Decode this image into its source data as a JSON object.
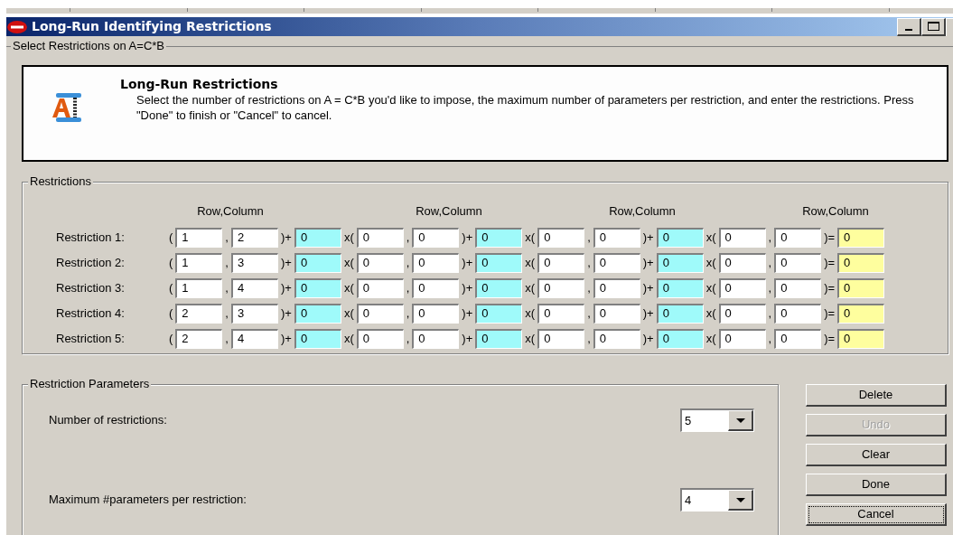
{
  "window": {
    "title": "Long-Run Identifying Restrictions"
  },
  "main_group": {
    "title": "Select Restrictions on A=C*B"
  },
  "info": {
    "heading": "Long-Run Restrictions",
    "text": "Select the number of restrictions on A = C*B you'd like to impose, the maximum number of parameters per restriction, and enter the restrictions. Press \"Done\" to finish or \"Cancel\" to cancel."
  },
  "restrictions": {
    "title": "Restrictions",
    "headers": [
      "Row,Column",
      "Row,Column",
      "Row,Column",
      "Row,Column"
    ],
    "rows": [
      {
        "label": "Restriction 1:",
        "items": [
          {
            "kind": "sep",
            "text": "("
          },
          {
            "kind": "cell",
            "value": "1"
          },
          {
            "kind": "sep",
            "text": ","
          },
          {
            "kind": "cell",
            "value": "2"
          },
          {
            "kind": "sep",
            "text": ")+"
          },
          {
            "kind": "coef",
            "value": "0"
          },
          {
            "kind": "sep",
            "text": "x("
          },
          {
            "kind": "cell",
            "value": "0"
          },
          {
            "kind": "sep",
            "text": ","
          },
          {
            "kind": "cell",
            "value": "0"
          },
          {
            "kind": "sep",
            "text": ")+"
          },
          {
            "kind": "coef",
            "value": "0"
          },
          {
            "kind": "sep",
            "text": "x("
          },
          {
            "kind": "cell",
            "value": "0"
          },
          {
            "kind": "sep",
            "text": ","
          },
          {
            "kind": "cell",
            "value": "0"
          },
          {
            "kind": "sep",
            "text": ")+"
          },
          {
            "kind": "coef",
            "value": "0"
          },
          {
            "kind": "sep",
            "text": "x("
          },
          {
            "kind": "cell",
            "value": "0"
          },
          {
            "kind": "sep",
            "text": ","
          },
          {
            "kind": "cell",
            "value": "0"
          },
          {
            "kind": "sep",
            "text": ")="
          },
          {
            "kind": "rhs",
            "value": "0"
          }
        ]
      },
      {
        "label": "Restriction 2:",
        "items": [
          {
            "kind": "sep",
            "text": "("
          },
          {
            "kind": "cell",
            "value": "1"
          },
          {
            "kind": "sep",
            "text": ","
          },
          {
            "kind": "cell",
            "value": "3"
          },
          {
            "kind": "sep",
            "text": ")+"
          },
          {
            "kind": "coef",
            "value": "0"
          },
          {
            "kind": "sep",
            "text": "x("
          },
          {
            "kind": "cell",
            "value": "0"
          },
          {
            "kind": "sep",
            "text": ","
          },
          {
            "kind": "cell",
            "value": "0"
          },
          {
            "kind": "sep",
            "text": ")+"
          },
          {
            "kind": "coef",
            "value": "0"
          },
          {
            "kind": "sep",
            "text": "x("
          },
          {
            "kind": "cell",
            "value": "0"
          },
          {
            "kind": "sep",
            "text": ","
          },
          {
            "kind": "cell",
            "value": "0"
          },
          {
            "kind": "sep",
            "text": ")+"
          },
          {
            "kind": "coef",
            "value": "0"
          },
          {
            "kind": "sep",
            "text": "x("
          },
          {
            "kind": "cell",
            "value": "0"
          },
          {
            "kind": "sep",
            "text": ","
          },
          {
            "kind": "cell",
            "value": "0"
          },
          {
            "kind": "sep",
            "text": ")="
          },
          {
            "kind": "rhs",
            "value": "0"
          }
        ]
      },
      {
        "label": "Restriction 3:",
        "items": [
          {
            "kind": "sep",
            "text": "("
          },
          {
            "kind": "cell",
            "value": "1"
          },
          {
            "kind": "sep",
            "text": ","
          },
          {
            "kind": "cell",
            "value": "4"
          },
          {
            "kind": "sep",
            "text": ")+"
          },
          {
            "kind": "coef",
            "value": "0"
          },
          {
            "kind": "sep",
            "text": "x("
          },
          {
            "kind": "cell",
            "value": "0"
          },
          {
            "kind": "sep",
            "text": ","
          },
          {
            "kind": "cell",
            "value": "0"
          },
          {
            "kind": "sep",
            "text": ")+"
          },
          {
            "kind": "coef",
            "value": "0"
          },
          {
            "kind": "sep",
            "text": "x("
          },
          {
            "kind": "cell",
            "value": "0"
          },
          {
            "kind": "sep",
            "text": ","
          },
          {
            "kind": "cell",
            "value": "0"
          },
          {
            "kind": "sep",
            "text": ")+"
          },
          {
            "kind": "coef",
            "value": "0"
          },
          {
            "kind": "sep",
            "text": "x("
          },
          {
            "kind": "cell",
            "value": "0"
          },
          {
            "kind": "sep",
            "text": ","
          },
          {
            "kind": "cell",
            "value": "0"
          },
          {
            "kind": "sep",
            "text": ")="
          },
          {
            "kind": "rhs",
            "value": "0"
          }
        ]
      },
      {
        "label": "Restriction 4:",
        "items": [
          {
            "kind": "sep",
            "text": "("
          },
          {
            "kind": "cell",
            "value": "2"
          },
          {
            "kind": "sep",
            "text": ","
          },
          {
            "kind": "cell",
            "value": "3"
          },
          {
            "kind": "sep",
            "text": ")+"
          },
          {
            "kind": "coef",
            "value": "0"
          },
          {
            "kind": "sep",
            "text": "x("
          },
          {
            "kind": "cell",
            "value": "0"
          },
          {
            "kind": "sep",
            "text": ","
          },
          {
            "kind": "cell",
            "value": "0"
          },
          {
            "kind": "sep",
            "text": ")+"
          },
          {
            "kind": "coef",
            "value": "0"
          },
          {
            "kind": "sep",
            "text": "x("
          },
          {
            "kind": "cell",
            "value": "0"
          },
          {
            "kind": "sep",
            "text": ","
          },
          {
            "kind": "cell",
            "value": "0"
          },
          {
            "kind": "sep",
            "text": ")+"
          },
          {
            "kind": "coef",
            "value": "0"
          },
          {
            "kind": "sep",
            "text": "x("
          },
          {
            "kind": "cell",
            "value": "0"
          },
          {
            "kind": "sep",
            "text": ","
          },
          {
            "kind": "cell",
            "value": "0"
          },
          {
            "kind": "sep",
            "text": ")="
          },
          {
            "kind": "rhs",
            "value": "0"
          }
        ]
      },
      {
        "label": "Restriction 5:",
        "items": [
          {
            "kind": "sep",
            "text": "("
          },
          {
            "kind": "cell",
            "value": "2"
          },
          {
            "kind": "sep",
            "text": ","
          },
          {
            "kind": "cell",
            "value": "4"
          },
          {
            "kind": "sep",
            "text": ")+"
          },
          {
            "kind": "coef",
            "value": "0"
          },
          {
            "kind": "sep",
            "text": "x("
          },
          {
            "kind": "cell",
            "value": "0"
          },
          {
            "kind": "sep",
            "text": ","
          },
          {
            "kind": "cell",
            "value": "0"
          },
          {
            "kind": "sep",
            "text": ")+"
          },
          {
            "kind": "coef",
            "value": "0"
          },
          {
            "kind": "sep",
            "text": "x("
          },
          {
            "kind": "cell",
            "value": "0"
          },
          {
            "kind": "sep",
            "text": ","
          },
          {
            "kind": "cell",
            "value": "0"
          },
          {
            "kind": "sep",
            "text": ")+"
          },
          {
            "kind": "coef",
            "value": "0"
          },
          {
            "kind": "sep",
            "text": "x("
          },
          {
            "kind": "cell",
            "value": "0"
          },
          {
            "kind": "sep",
            "text": ","
          },
          {
            "kind": "cell",
            "value": "0"
          },
          {
            "kind": "sep",
            "text": ")="
          },
          {
            "kind": "rhs",
            "value": "0"
          }
        ]
      }
    ]
  },
  "parameters": {
    "title": "Restriction Parameters",
    "fields": [
      {
        "label": "Number of restrictions:",
        "value": "5"
      },
      {
        "label": "Maximum #parameters per restriction:",
        "value": "4"
      }
    ]
  },
  "buttons": [
    {
      "label": "Delete",
      "disabled": false,
      "focused": false
    },
    {
      "label": "Undo",
      "disabled": true,
      "focused": false
    },
    {
      "label": "Clear",
      "disabled": false,
      "focused": false
    },
    {
      "label": "Done",
      "disabled": false,
      "focused": false
    },
    {
      "label": "Cancel",
      "disabled": false,
      "focused": true
    }
  ]
}
